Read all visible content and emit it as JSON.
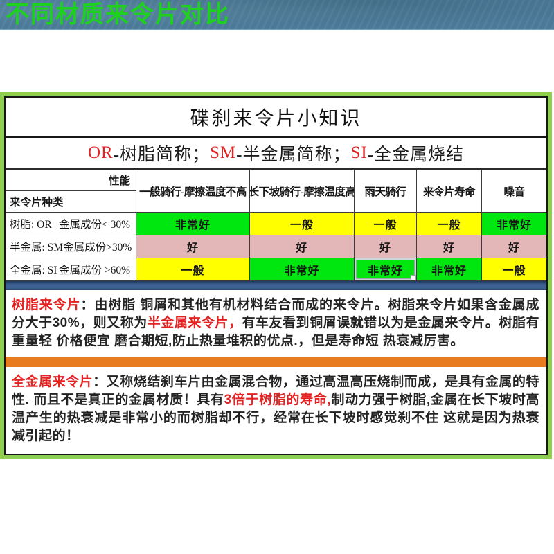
{
  "banner": {
    "title": "不同材质来令片对比"
  },
  "card": {
    "title": "碟刹来令片小知识",
    "subtitle_segments": [
      {
        "text": "OR",
        "color": "red"
      },
      {
        "text": "-树脂简称；",
        "color": "black"
      },
      {
        "text": "SM",
        "color": "red"
      },
      {
        "text": "-半金属简称；",
        "color": "black"
      },
      {
        "text": "SI",
        "color": "red"
      },
      {
        "text": "-全金属烧结",
        "color": "black"
      }
    ]
  },
  "table": {
    "corner": {
      "top_label": "性能",
      "bottom_label": "来令片种类"
    },
    "column_headers": [
      "一般骑行-摩擦温度不高",
      "长下坡骑行-摩擦温度高",
      "雨天骑行",
      "来令片寿命",
      "噪音"
    ],
    "rows": [
      {
        "label_left": "树脂: OR",
        "label_right": "金属成份< 30%",
        "cells": [
          {
            "text": "非常好",
            "tone": "green"
          },
          {
            "text": "一般",
            "tone": "yellow"
          },
          {
            "text": "一般",
            "tone": "yellow"
          },
          {
            "text": "一般",
            "tone": "yellow"
          },
          {
            "text": "非常好",
            "tone": "green"
          }
        ]
      },
      {
        "label_left": "半金属: SM",
        "label_right": "金属成份>30%",
        "cells": [
          {
            "text": "好",
            "tone": "pink"
          },
          {
            "text": "好",
            "tone": "pink"
          },
          {
            "text": "好",
            "tone": "pink"
          },
          {
            "text": "好",
            "tone": "pink"
          },
          {
            "text": "好",
            "tone": "pink"
          }
        ]
      },
      {
        "label_left": "全金属: SI",
        "label_right": "金属成份 >60%",
        "cells": [
          {
            "text": "一般",
            "tone": "yellow"
          },
          {
            "text": "非常好",
            "tone": "green"
          },
          {
            "text": "非常好",
            "tone": "green",
            "selected": true
          },
          {
            "text": "非常好",
            "tone": "green"
          },
          {
            "text": "一般",
            "tone": "yellow"
          }
        ]
      }
    ]
  },
  "paragraphs": [
    {
      "id": "resin",
      "segments": [
        {
          "text": "树脂来令片",
          "color": "red"
        },
        {
          "text": "：由树脂 铜屑和其他有机材料结合而成的来令片。树脂来令片如果含金属成分大于30%，则又称为",
          "color": "black"
        },
        {
          "text": "半金属来令片，",
          "color": "red"
        },
        {
          "text": "有车友看到铜屑误就错以为是金属来令片。树脂有重量轻 价格便宜 磨合期短,防止热量堆积的优点.，但是寿命短 热衰减厉害。",
          "color": "black"
        }
      ]
    },
    {
      "id": "full-metal",
      "segments": [
        {
          "text": "全金属来令片",
          "color": "red"
        },
        {
          "text": "：又称烧结刹车片由金属混合物，通过高温高压烧制而成，是具有金属的特性. 而且不是真正的金属材质！具有",
          "color": "black"
        },
        {
          "text": "3倍于树脂的寿命,",
          "color": "red"
        },
        {
          "text": "制动力强于树脂,金属在长下坡时高温产生的热衰减是非常小的而树脂却不行，经常在长下坡时感觉刹不住 这就是因为热衰减引起的！",
          "color": "black"
        }
      ]
    }
  ],
  "colors": {
    "banner_background": "#4a7a98",
    "banner_text": "#1fd11f",
    "frame_green": "#8ecf50",
    "cell_green": "#00e60f",
    "cell_yellow": "#ffff00",
    "cell_pink": "#e3b7b7",
    "divider_blue": "#3e6293",
    "divider_orange": "#e87b1e",
    "accent_red": "#e32222"
  }
}
